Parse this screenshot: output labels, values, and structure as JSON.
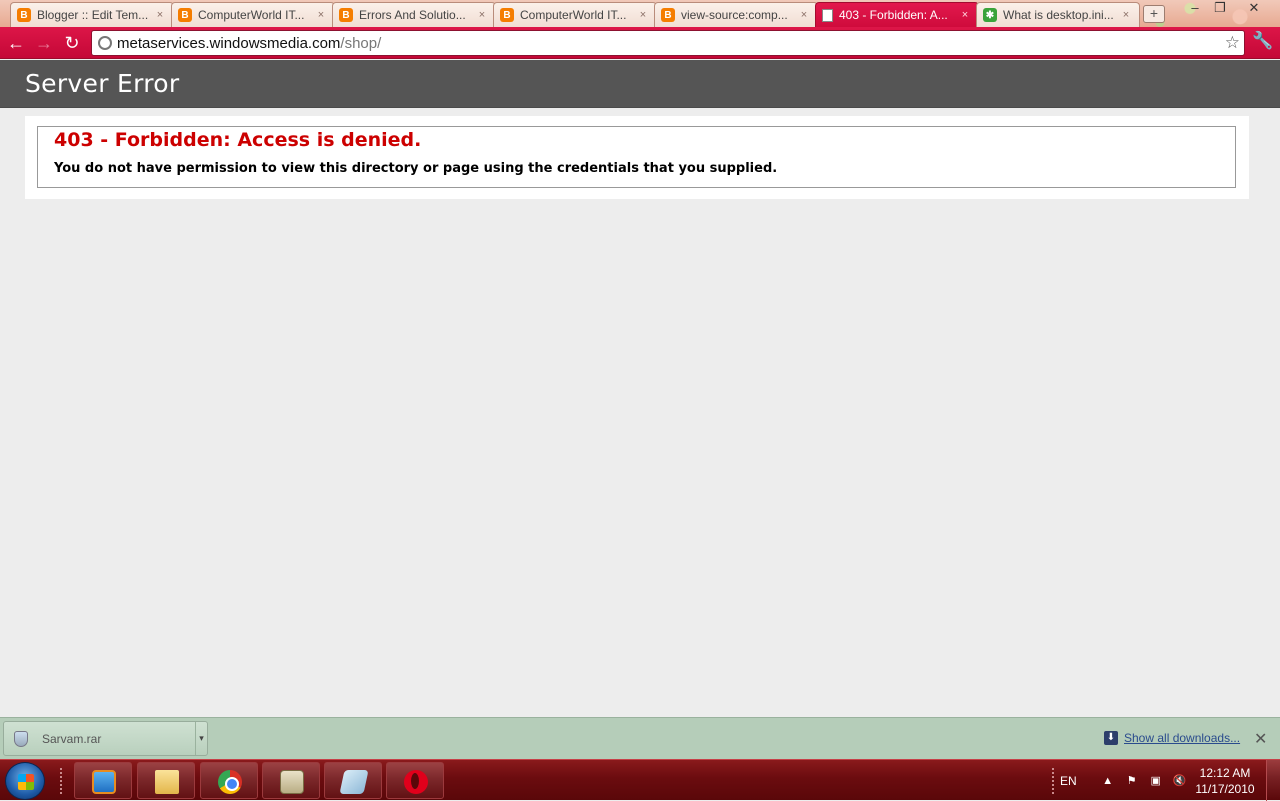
{
  "browser": {
    "tabs": [
      {
        "title": "Blogger :: Edit Tem...",
        "icon": "blogger-icon",
        "active": false
      },
      {
        "title": "ComputerWorld IT...",
        "icon": "blogger-icon",
        "active": false
      },
      {
        "title": "Errors And Solutio...",
        "icon": "blogger-icon",
        "active": false
      },
      {
        "title": "ComputerWorld IT...",
        "icon": "blogger-icon",
        "active": false
      },
      {
        "title": "view-source:comp...",
        "icon": "blogger-icon",
        "active": false
      },
      {
        "title": "403 - Forbidden: A...",
        "icon": "page-icon",
        "active": true
      },
      {
        "title": "What is desktop.ini...",
        "icon": "green-star-icon",
        "active": false
      }
    ],
    "tab_close_glyph": "×",
    "new_tab_glyph": "+",
    "window_controls": {
      "minimize": "–",
      "restore": "❐",
      "close": "✕"
    },
    "nav": {
      "back": "←",
      "forward": "→",
      "reload": "↻"
    },
    "address": {
      "host": "metaservices.windowsmedia.com",
      "path": "/shop/"
    },
    "star_glyph": "☆",
    "wrench_glyph": "🔧"
  },
  "page": {
    "header_title": "Server Error",
    "error_title": "403 - Forbidden: Access is denied.",
    "error_message": "You do not have permission to view this directory or page using the credentials that you supplied."
  },
  "downloads": {
    "item_name": "Sarvam.rar",
    "item_menu_glyph": "▾",
    "show_all_label": "Show all downloads...",
    "show_all_icon_glyph": "⬇",
    "close_glyph": "✕"
  },
  "taskbar": {
    "language": "EN",
    "tray_expand_glyph": "▲",
    "tray_icons": [
      "⚑",
      "▣",
      "🔇"
    ],
    "time": "12:12 AM",
    "date": "11/17/2010"
  },
  "colors": {
    "toolbar_accent": "#d5103f",
    "page_header_bg": "#555555",
    "error_red": "#cc0000",
    "download_shelf": "#b5cdb9",
    "taskbar": "#6b0c0f"
  }
}
